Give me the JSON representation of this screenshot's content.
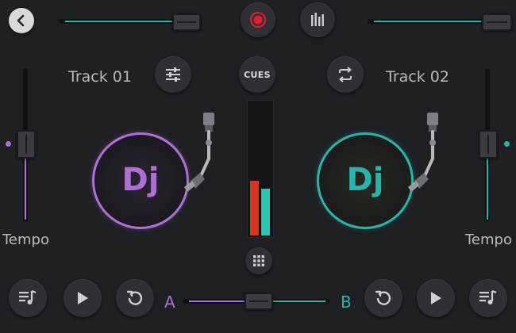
{
  "colors": {
    "background": "#1f2024",
    "deck_a": "#b06fd8",
    "deck_b": "#2ab3ad",
    "record": "#e0202e",
    "vu_red": "#d9331d",
    "vu_teal": "#2ec4b0"
  },
  "top_bar": {
    "back_icon": "chevron-left-icon",
    "record_icon": "record-icon",
    "equalizer_icon": "equalizer-bars-icon"
  },
  "center": {
    "cues_label": "CUES",
    "grid_icon": "grid-icon",
    "vu_meter": {
      "left_level": 0.41,
      "right_level": 0.35
    }
  },
  "deck_a": {
    "track_label": "Track 01",
    "settings_icon": "sliders-icon",
    "tempo_label": "Tempo",
    "platter_label": "Dj",
    "volume_level": 0.95,
    "tempo_position": 0.5
  },
  "deck_b": {
    "track_label": "Track 02",
    "sync_icon": "swap-arrows-icon",
    "tempo_label": "Tempo",
    "platter_label": "Dj",
    "volume_level": 0.95,
    "tempo_position": 0.5
  },
  "bottom_bar": {
    "crossfader_left_label": "A",
    "crossfader_right_label": "B",
    "crossfader_position": 0.5
  }
}
